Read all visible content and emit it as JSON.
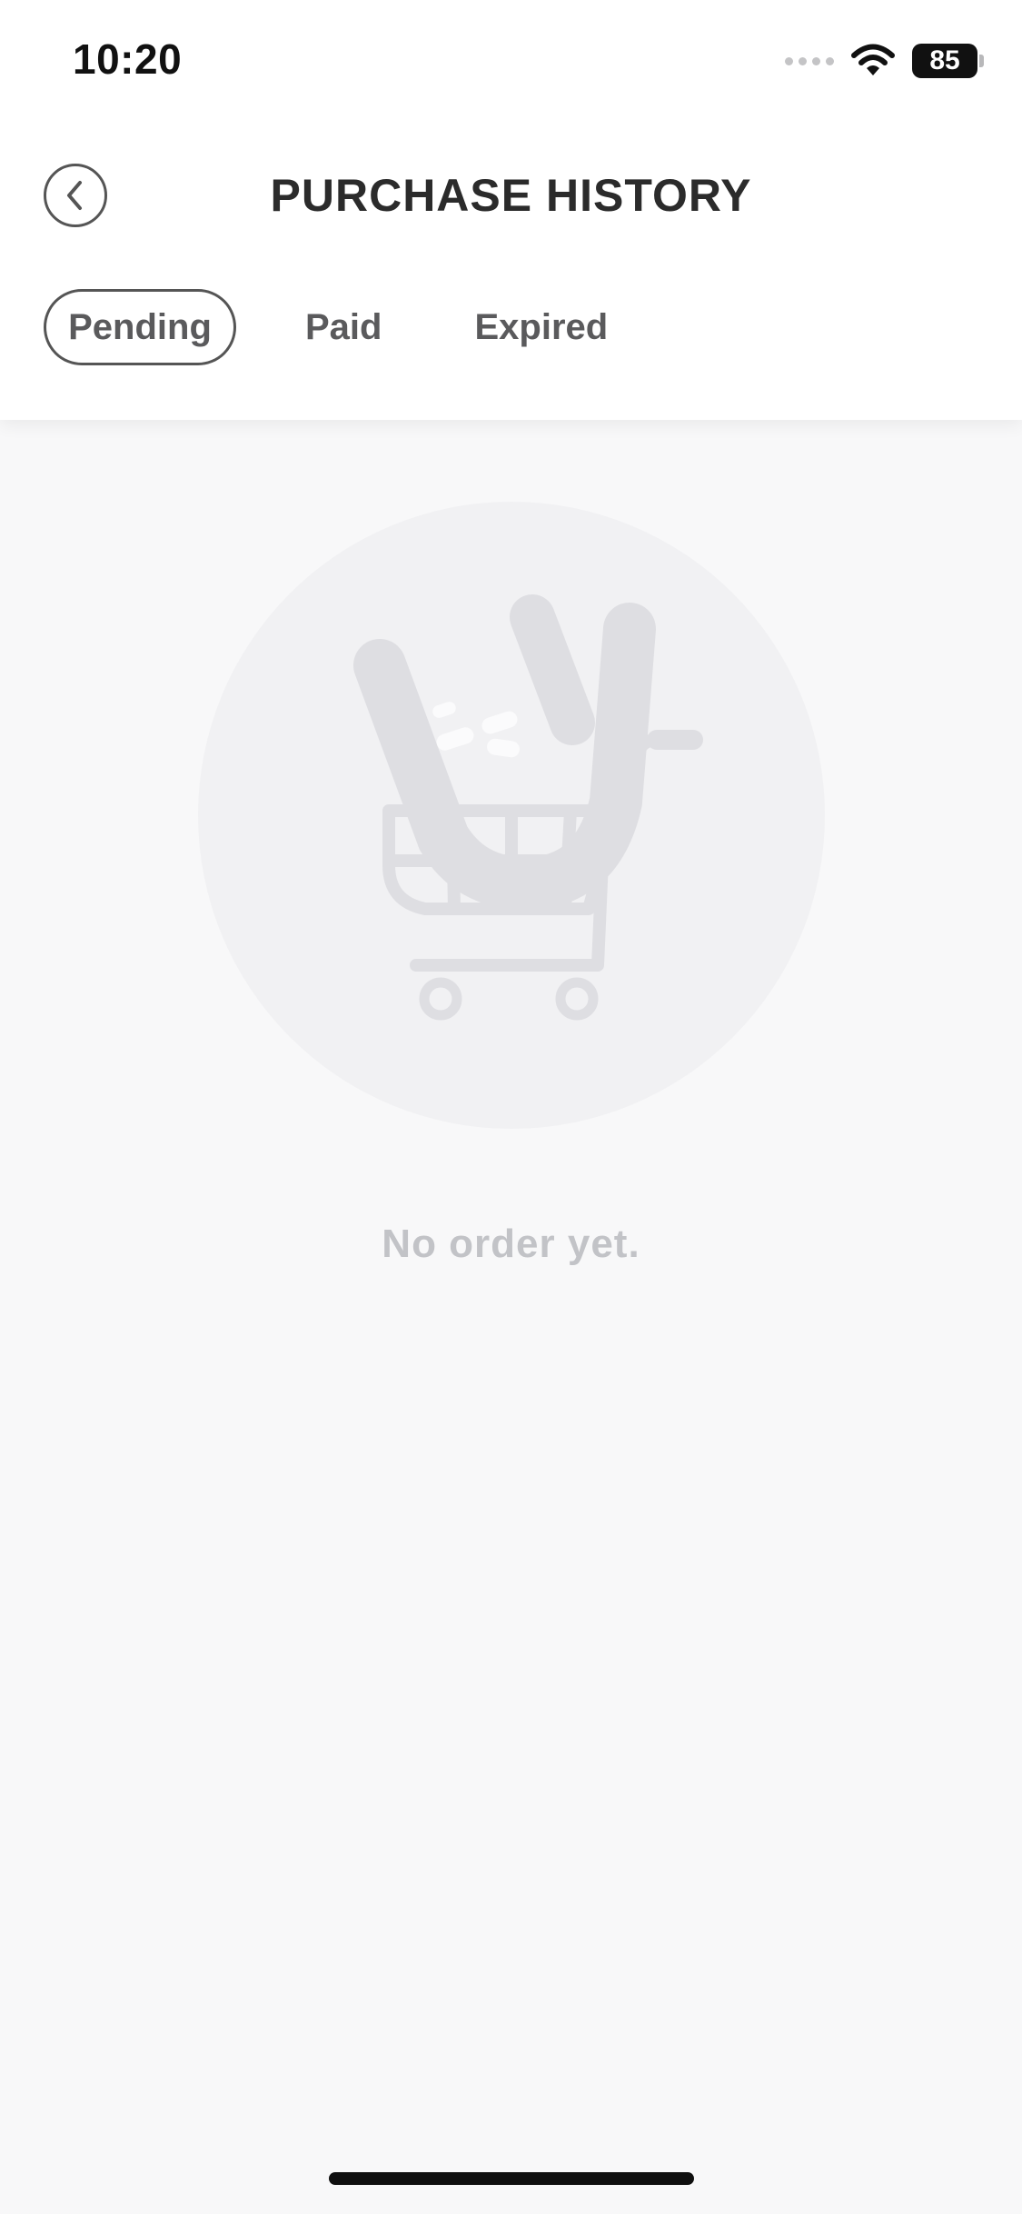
{
  "status_bar": {
    "time": "10:20",
    "battery": "85"
  },
  "header": {
    "title": "PURCHASE HISTORY",
    "back_icon": "chevron-left-icon"
  },
  "tabs": [
    {
      "label": "Pending",
      "active": true
    },
    {
      "label": "Paid",
      "active": false
    },
    {
      "label": "Expired",
      "active": false
    }
  ],
  "empty_state": {
    "icon": "shopping-cart-icon",
    "message": "No order yet."
  },
  "colors": {
    "background": "#f8f8f9",
    "panel": "#ffffff",
    "text_dark": "#2b2b2b",
    "tab_text": "#5a5a5c",
    "muted": "#c2c3c7",
    "illustration": "#dcdce0"
  }
}
